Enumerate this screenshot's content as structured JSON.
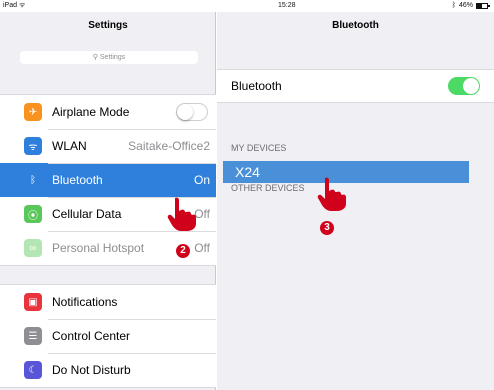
{
  "status_bar": {
    "device": "iPad",
    "time": "15:28",
    "battery": "46%"
  },
  "master": {
    "title": "Settings",
    "search_placeholder": "Settings",
    "group1": [
      {
        "icon": "airplane-icon",
        "color": "#f7931e",
        "label": "Airplane Mode",
        "value": ""
      },
      {
        "icon": "wifi-icon",
        "color": "#2f80dd",
        "label": "WLAN",
        "value": "Saitake-Office2"
      },
      {
        "icon": "bluetooth-icon",
        "color": "#2f80dd",
        "label": "Bluetooth",
        "value": "On"
      },
      {
        "icon": "cellular-icon",
        "color": "#5ac75a",
        "label": "Cellular Data",
        "value": "Off"
      },
      {
        "icon": "hotspot-icon",
        "color": "#5ac75a",
        "label": "Personal Hotspot",
        "value": "Off"
      }
    ],
    "group2": [
      {
        "icon": "notifications-icon",
        "color": "#e8343c",
        "label": "Notifications"
      },
      {
        "icon": "control-center-icon",
        "color": "#8e8e93",
        "label": "Control Center"
      },
      {
        "icon": "moon-icon",
        "color": "#5856d6",
        "label": "Do Not Disturb"
      }
    ]
  },
  "detail": {
    "title": "Bluetooth",
    "bluetooth_label": "Bluetooth",
    "my_devices_header": "MY DEVICES",
    "device_name": "X24",
    "other_devices_header": "OTHER DEVICES"
  },
  "annotations": {
    "step2": "2",
    "step3": "3",
    "accent": "#d0021b"
  }
}
